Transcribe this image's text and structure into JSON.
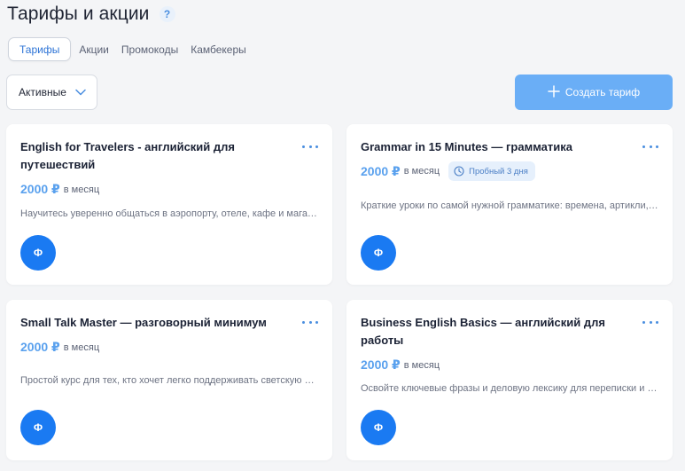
{
  "header": {
    "title": "Тарифы и акции",
    "help_glyph": "?"
  },
  "tabs": [
    {
      "label": "Тарифы",
      "active": true
    },
    {
      "label": "Акции",
      "active": false
    },
    {
      "label": "Промокоды",
      "active": false
    },
    {
      "label": "Камбекеры",
      "active": false
    }
  ],
  "filter": {
    "selected": "Активные",
    "icon": "chevron-down-icon"
  },
  "create_button": {
    "label": "Создать тариф",
    "icon": "plus-icon"
  },
  "colors": {
    "accent": "#6aaef6",
    "price": "#5aa1ee",
    "avatar": "#1a7af2",
    "background": "#f4f5f7"
  },
  "cards": [
    {
      "title": "English for Travelers - английский для путешествий",
      "price": "2000 ₽",
      "period": "в месяц",
      "badge": null,
      "description": "Научитесь уверенно общаться в аэропорту, отеле, кафе и магазине во время путешествий",
      "avatar": "Ф"
    },
    {
      "title": "Grammar in 15 Minutes — грамматика",
      "price": "2000 ₽",
      "period": "в месяц",
      "badge": "Пробный 3 дня",
      "description": "Краткие уроки по самой нужной грамматике: времена, артикли, предлоги",
      "avatar": "Ф"
    },
    {
      "title": "Small Talk Master — разговорный минимум",
      "price": "2000 ₽",
      "period": "в месяц",
      "badge": null,
      "description": "Простой курс для тех, кто хочет легко поддерживать светскую беседу",
      "avatar": "Ф"
    },
    {
      "title": "Business English Basics — английский для работы",
      "price": "2000 ₽",
      "period": "в месяц",
      "badge": null,
      "description": "Освойте ключевые фразы и деловую лексику для переписки и встреч",
      "avatar": "Ф"
    }
  ]
}
